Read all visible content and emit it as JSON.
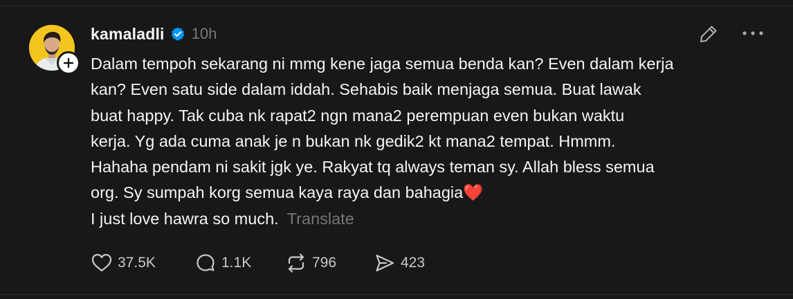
{
  "post": {
    "username": "kamaladli",
    "verified": true,
    "timestamp": "10h",
    "lines": [
      "Dalam tempoh sekarang ni mmg kene jaga semua benda kan? Even dalam kerja",
      "kan? Even satu side dalam iddah. Sehabis baik menjaga semua. Buat lawak",
      "buat happy. Tak cuba nk rapat2 ngn mana2 perempuan even bukan waktu",
      "kerja. Yg ada cuma anak je n bukan nk gedik2 kt mana2 tempat. Hmmm.",
      "Hahaha pendam ni sakit jgk ye. Rakyat tq always teman sy. Allah bless semua",
      "org. Sy sumpah korg semua kaya raya dan bahagia❤️",
      "I just love hawra so much."
    ],
    "translate_label": "Translate"
  },
  "actions": {
    "likes": "37.5K",
    "replies": "1.1K",
    "reposts": "796",
    "shares": "423"
  },
  "icons": {
    "avatar": "profile-photo",
    "follow": "plus-icon",
    "verified": "verified-badge-icon",
    "edit": "pencil-icon",
    "more": "more-dots-icon",
    "like": "heart-icon",
    "reply": "comment-icon",
    "repost": "repost-icon",
    "share": "send-icon"
  },
  "colors": {
    "background": "#181818",
    "text": "#f3f5f7",
    "muted": "#777777",
    "verified": "#0095f6",
    "avatar_bg": "#f3c51e"
  }
}
